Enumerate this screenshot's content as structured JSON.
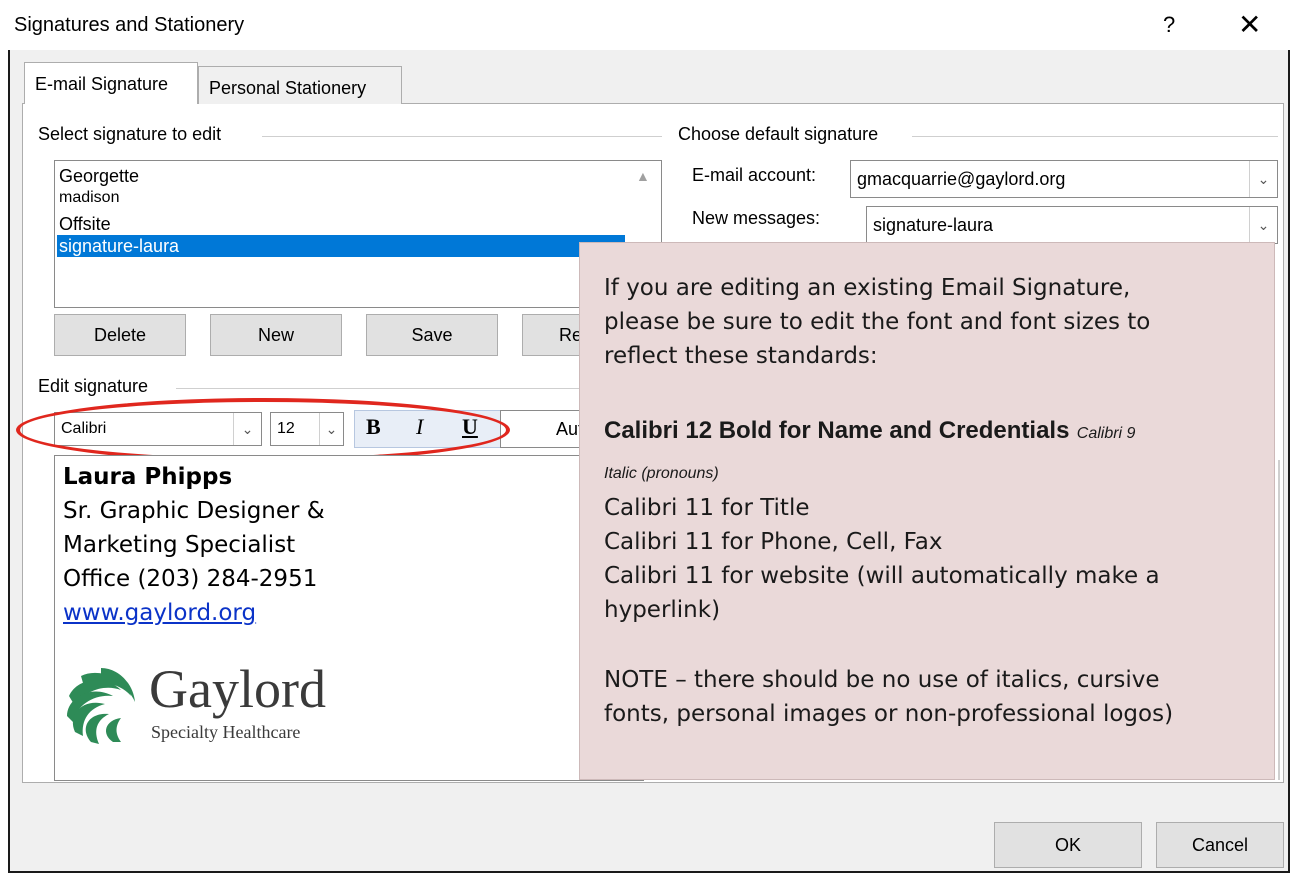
{
  "dialog": {
    "title": "Signatures and Stationery",
    "help_glyph": "?",
    "close_glyph": "✕"
  },
  "tabs": [
    {
      "label": "E-mail Signature",
      "active": true
    },
    {
      "label": "Personal Stationery",
      "active": false
    }
  ],
  "select_signature": {
    "group_label": "Select signature to edit",
    "items": [
      "Georgette",
      "madison",
      "Offsite",
      "signature-laura"
    ],
    "selected": "signature-laura",
    "buttons": [
      "Delete",
      "New",
      "Save",
      "Re"
    ]
  },
  "default_signature": {
    "group_label": "Choose default signature",
    "account_label": "E-mail account:",
    "account_value": "gmacquarrie@gaylord.org",
    "new_messages_label": "New messages:",
    "new_messages_value": "signature-laura"
  },
  "edit_signature": {
    "group_label": "Edit signature",
    "font": "Calibri",
    "size": "12",
    "bold_glyph": "B",
    "italic_glyph": "I",
    "underline_glyph": "U",
    "color_label": "Aut",
    "lines": {
      "name": "Laura Phipps",
      "title1": "Sr. Graphic Designer &",
      "title2": "Marketing Specialist",
      "office": "Office (203) 284-2951",
      "website": "www.gaylord.org"
    },
    "logo": {
      "name": "Gaylord",
      "tagline": "Specialty Healthcare",
      "color": "#2e8b57"
    }
  },
  "note": {
    "intro1": "If you are editing an existing Email Signature,",
    "intro2": "please be sure to edit the font and font sizes to",
    "intro3": "reflect these standards:",
    "bold_rule": "Calibri 12 Bold for Name and Credentials",
    "italic_rule_a": "Calibri 9",
    "italic_rule_b": "Italic (pronouns)",
    "rule_title": "Calibri 11 for Title",
    "rule_phone": "Calibri 11 for Phone, Cell, Fax",
    "rule_web1": "Calibri 11 for website (will automatically make a",
    "rule_web2": "hyperlink)",
    "note1": "NOTE – there should be no use of italics, cursive",
    "note2": "fonts, personal images or non-professional logos)"
  },
  "footer": {
    "ok": "OK",
    "cancel": "Cancel"
  },
  "colors": {
    "selection": "#0078d7",
    "highlight_ellipse": "#e0271e",
    "note_background": "#ead9d9",
    "link": "#0b33c8"
  }
}
